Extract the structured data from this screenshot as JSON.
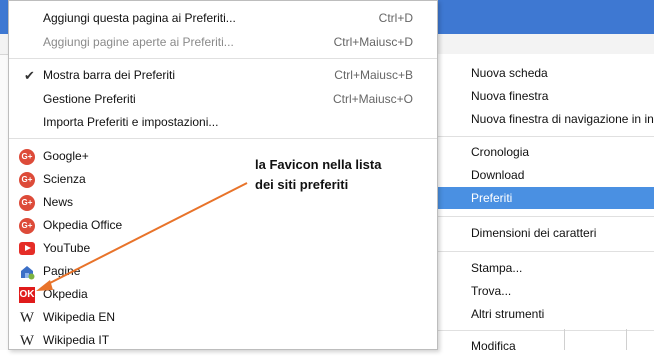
{
  "bookmarks_menu": {
    "commands": [
      {
        "label": "Aggiungi questa pagina ai Preferiti...",
        "shortcut": "Ctrl+D",
        "disabled": false
      },
      {
        "label": "Aggiungi pagine aperte ai Preferiti...",
        "shortcut": "Ctrl+Maiusc+D",
        "disabled": true
      }
    ],
    "settings": [
      {
        "label": "Mostra barra dei Preferiti",
        "shortcut": "Ctrl+Maiusc+B",
        "checked": true
      },
      {
        "label": "Gestione Preferiti",
        "shortcut": "Ctrl+Maiusc+O",
        "checked": false
      },
      {
        "label": "Importa Preferiti e impostazioni...",
        "shortcut": "",
        "checked": false
      }
    ],
    "bookmarks": [
      {
        "label": "Google+",
        "icon": "google-plus-icon"
      },
      {
        "label": "Scienza",
        "icon": "google-plus-icon"
      },
      {
        "label": "News",
        "icon": "google-plus-icon"
      },
      {
        "label": "Okpedia Office",
        "icon": "google-plus-icon"
      },
      {
        "label": "YouTube",
        "icon": "youtube-icon"
      },
      {
        "label": "Pagine",
        "icon": "pages-icon"
      },
      {
        "label": "Okpedia",
        "icon": "okpedia-icon"
      },
      {
        "label": "Wikipedia EN",
        "icon": "wikipedia-icon"
      },
      {
        "label": "Wikipedia IT",
        "icon": "wikipedia-icon"
      }
    ],
    "icon_glyphs": {
      "gplus": "G+",
      "ok": "OK",
      "wiki": "W"
    }
  },
  "chrome_menu": {
    "items": [
      {
        "label": "Nuova scheda"
      },
      {
        "label": "Nuova finestra"
      },
      {
        "label": "Nuova finestra di navigazione in incognito"
      },
      {
        "label": "Cronologia"
      },
      {
        "label": "Download"
      },
      {
        "label": "Preferiti",
        "highlighted": true
      },
      {
        "label": "Dimensioni dei caratteri"
      },
      {
        "label": "Stampa..."
      },
      {
        "label": "Trova..."
      },
      {
        "label": "Altri strumenti"
      },
      {
        "label": "Modifica"
      }
    ]
  },
  "annotation": {
    "line1": "la Favicon nella lista",
    "line2": "dei siti preferiti",
    "arrow_color": "#e8732a"
  },
  "colors": {
    "titlebar": "#3e78d2",
    "highlight": "#4a90e2",
    "gplus": "#dd4b39",
    "ok": "#e01b1b"
  }
}
